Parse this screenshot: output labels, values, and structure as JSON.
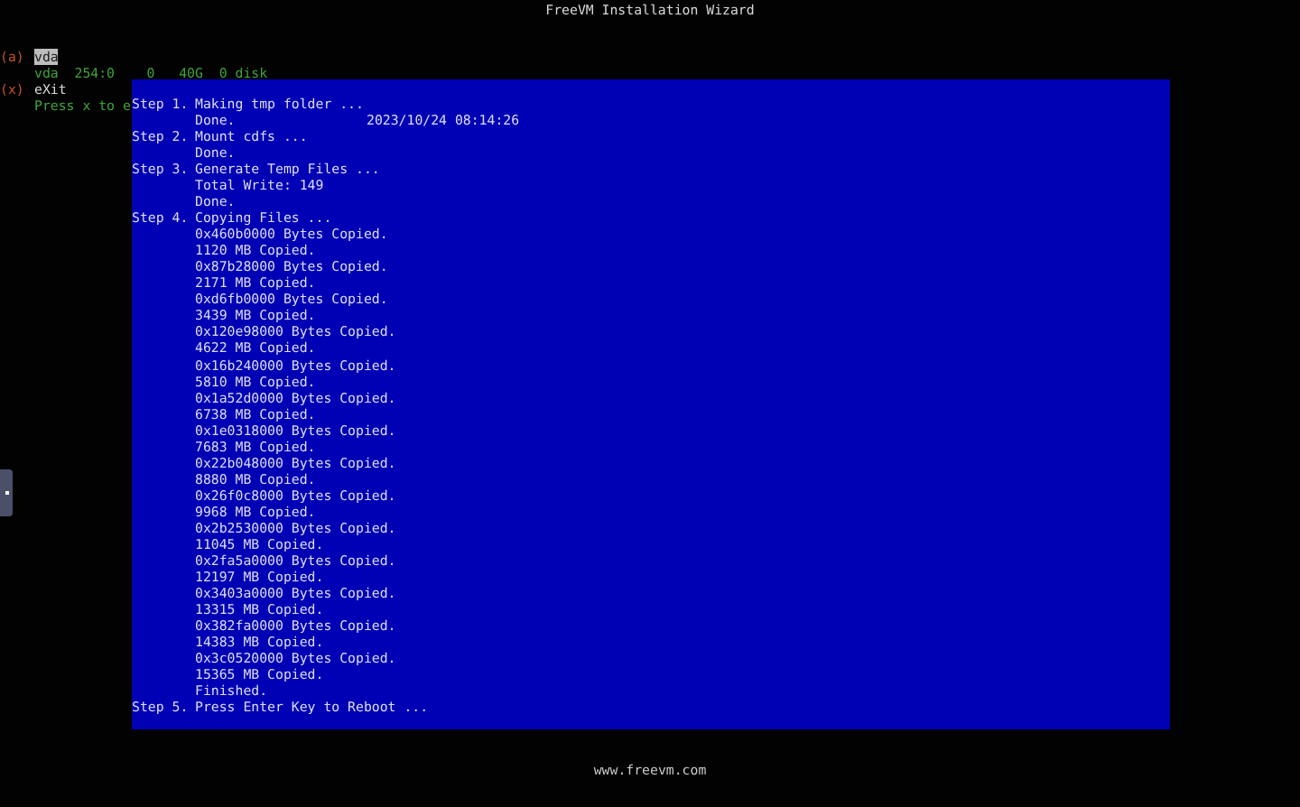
{
  "window": {
    "title": "FreeVM Installation Wizard"
  },
  "menu": {
    "items": [
      {
        "key": "(a)",
        "label": "vda",
        "selected": true,
        "info": "vda  254:0    0   40G  0 disk"
      },
      {
        "key": "(x)",
        "label": "eXit",
        "selected": false
      }
    ],
    "hint": "Press x to e"
  },
  "log": {
    "steps": [
      {
        "number": "Step 1.",
        "title": "Making tmp folder ...",
        "details": [
          {
            "text": "Done.",
            "timestamp": "2023/10/24 08:14:26"
          }
        ]
      },
      {
        "number": "Step 2.",
        "title": "Mount cdfs ...",
        "details": [
          {
            "text": "Done."
          }
        ]
      },
      {
        "number": "Step 3.",
        "title": "Generate Temp Files ...",
        "details": [
          {
            "text": "Total Write: 149"
          },
          {
            "text": "Done."
          }
        ]
      },
      {
        "number": "Step 4.",
        "title": "Copying Files ...",
        "details": [
          {
            "text": "0x460b0000 Bytes Copied."
          },
          {
            "text": "1120 MB Copied."
          },
          {
            "text": "0x87b28000 Bytes Copied."
          },
          {
            "text": "2171 MB Copied."
          },
          {
            "text": "0xd6fb0000 Bytes Copied."
          },
          {
            "text": "3439 MB Copied."
          },
          {
            "text": "0x120e98000 Bytes Copied."
          },
          {
            "text": "4622 MB Copied."
          },
          {
            "text": "0x16b240000 Bytes Copied."
          },
          {
            "text": "5810 MB Copied."
          },
          {
            "text": "0x1a52d0000 Bytes Copied."
          },
          {
            "text": "6738 MB Copied."
          },
          {
            "text": "0x1e0318000 Bytes Copied."
          },
          {
            "text": "7683 MB Copied."
          },
          {
            "text": "0x22b048000 Bytes Copied."
          },
          {
            "text": "8880 MB Copied."
          },
          {
            "text": "0x26f0c8000 Bytes Copied."
          },
          {
            "text": "9968 MB Copied."
          },
          {
            "text": "0x2b2530000 Bytes Copied."
          },
          {
            "text": "11045 MB Copied."
          },
          {
            "text": "0x2fa5a0000 Bytes Copied."
          },
          {
            "text": "12197 MB Copied."
          },
          {
            "text": "0x3403a0000 Bytes Copied."
          },
          {
            "text": "13315 MB Copied."
          },
          {
            "text": "0x382fa0000 Bytes Copied."
          },
          {
            "text": "14383 MB Copied."
          },
          {
            "text": "0x3c0520000 Bytes Copied."
          },
          {
            "text": "15365 MB Copied."
          },
          {
            "text": "Finished."
          }
        ]
      },
      {
        "number": "Step 5.",
        "title": "Press Enter Key to Reboot ..."
      }
    ]
  },
  "footer": {
    "url": "www.freevm.com"
  }
}
